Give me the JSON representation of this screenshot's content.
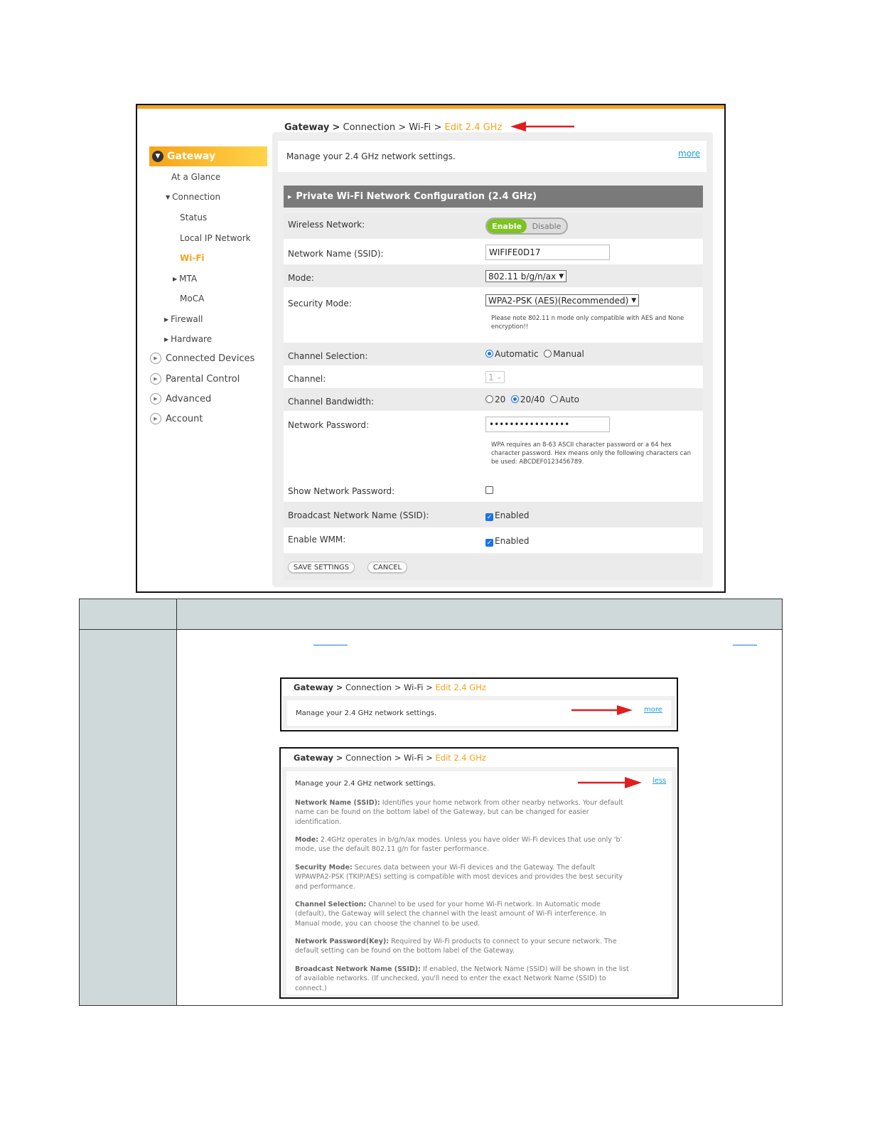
{
  "breadcrumb": {
    "root": "Gateway",
    "sep": ">",
    "level2": "Connection",
    "level3": "Wi-Fi",
    "current": "Edit 2.4 GHz"
  },
  "sidebar": {
    "gateway": "Gateway",
    "items": [
      "At a Glance",
      "Connection",
      "Status",
      "Local IP Network",
      "Wi-Fi",
      "MTA",
      "MoCA",
      "Firewall",
      "Hardware"
    ],
    "top_items": [
      "Connected Devices",
      "Parental Control",
      "Advanced",
      "Account"
    ]
  },
  "manage_text": "Manage your 2.4 GHz network settings.",
  "more_label": "more",
  "less_label": "less",
  "config": {
    "title": "Private Wi-Fi Network Configuration (2.4 GHz)",
    "wireless_label": "Wireless Network:",
    "enable": "Enable",
    "disable": "Disable",
    "ssid_label": "Network Name (SSID):",
    "ssid_value": "WIFIFE0D17",
    "mode_label": "Mode:",
    "mode_value": "802.11 b/g/n/ax",
    "security_label": "Security Mode:",
    "security_value": "WPA2-PSK (AES)(Recommended)",
    "security_note": "Please note 802.11 n mode only compatible with AES and None encryption!!",
    "channel_sel_label": "Channel Selection:",
    "automatic": "Automatic",
    "manual": "Manual",
    "channel_label": "Channel:",
    "channel_value": "1",
    "bandwidth_label": "Channel Bandwidth:",
    "bw_20": "20",
    "bw_2040": "20/40",
    "bw_auto": "Auto",
    "password_label": "Network Password:",
    "password_value": "••••••••••••••••",
    "password_note": "WPA requires an 8-63 ASCII character password or a 64 hex character password. Hex means only the following characters can be used: ABCDEF0123456789.",
    "show_pw_label": "Show Network Password:",
    "broadcast_label": "Broadcast Network Name (SSID):",
    "enabled": "Enabled",
    "wmm_label": "Enable WMM:",
    "save": "SAVE SETTINGS",
    "cancel": "CANCEL"
  },
  "help": [
    {
      "term": "Network Name (SSID):",
      "text": " Identifies your home network from other nearby networks. Your default name can be found on the bottom label of the Gateway, but can be changed for easier identification."
    },
    {
      "term": "Mode:",
      "text": " 2.4GHz operates in b/g/n/ax modes. Unless you have older Wi-Fi devices that use only 'b' mode, use the default 802.11 g/n for faster performance."
    },
    {
      "term": "Security Mode:",
      "text": " Secures data between your Wi-Fi devices and the Gateway. The default WPAWPA2-PSK (TKIP/AES) setting is compatible with most devices and provides the best security and performance."
    },
    {
      "term": "Channel Selection:",
      "text": " Channel to be used for your home Wi-Fi network. In Automatic mode (default), the Gateway will select the channel with the least amount of Wi-Fi interference. In Manual mode, you can choose the channel to be used."
    },
    {
      "term": "Network Password(Key):",
      "text": " Required by Wi-Fi products to connect to your secure network. The default setting can be found on the bottom label of the Gateway."
    },
    {
      "term": "Broadcast Network Name (SSID):",
      "text": " If enabled, the Network Name (SSID) will be shown in the list of available networks. (If unchecked, you'll need to enter the exact Network Name (SSID) to connect.)"
    }
  ],
  "colors": {
    "accent": "#f5a31a",
    "link": "#1a9ed8",
    "toggle_on": "#7cc41e",
    "arrow": "#e01e1e",
    "table_header": "#cfd9da"
  }
}
